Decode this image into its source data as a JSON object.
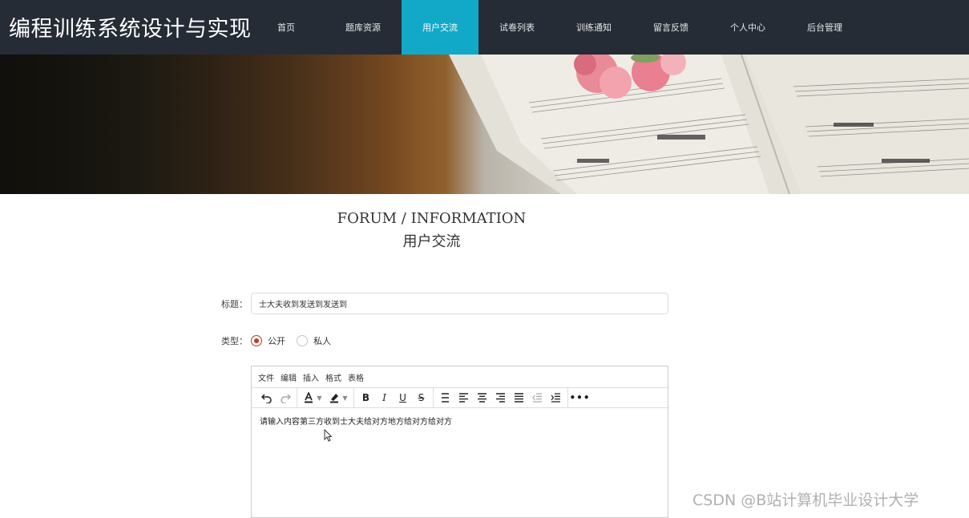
{
  "header": {
    "brand": "编程训练系统设计与实现",
    "nav": [
      {
        "label": "首页",
        "active": false
      },
      {
        "label": "题库资源",
        "active": false
      },
      {
        "label": "用户交流",
        "active": true
      },
      {
        "label": "试卷列表",
        "active": false
      },
      {
        "label": "训练通知",
        "active": false
      },
      {
        "label": "留言反馈",
        "active": false
      },
      {
        "label": "个人中心",
        "active": false
      },
      {
        "label": "后台管理",
        "active": false
      }
    ]
  },
  "section": {
    "title_en": "FORUM / INFORMATION",
    "title_zh": "用户交流"
  },
  "form": {
    "title_label": "标题：",
    "title_value": "士大夫收到发送到发送到",
    "type_label": "类型：",
    "type_options": [
      {
        "label": "公开",
        "checked": true
      },
      {
        "label": "私人",
        "checked": false
      }
    ]
  },
  "editor": {
    "menu": [
      "文件",
      "编辑",
      "插入",
      "格式",
      "表格"
    ],
    "content": "请输入内容第三方收到士大夫给对方地方给对方给对方"
  },
  "colors": {
    "nav_bg": "#252c35",
    "nav_active": "#12a9c8",
    "radio_checked": "#c0392b"
  },
  "watermark": "CSDN @B站计算机毕业设计大学"
}
